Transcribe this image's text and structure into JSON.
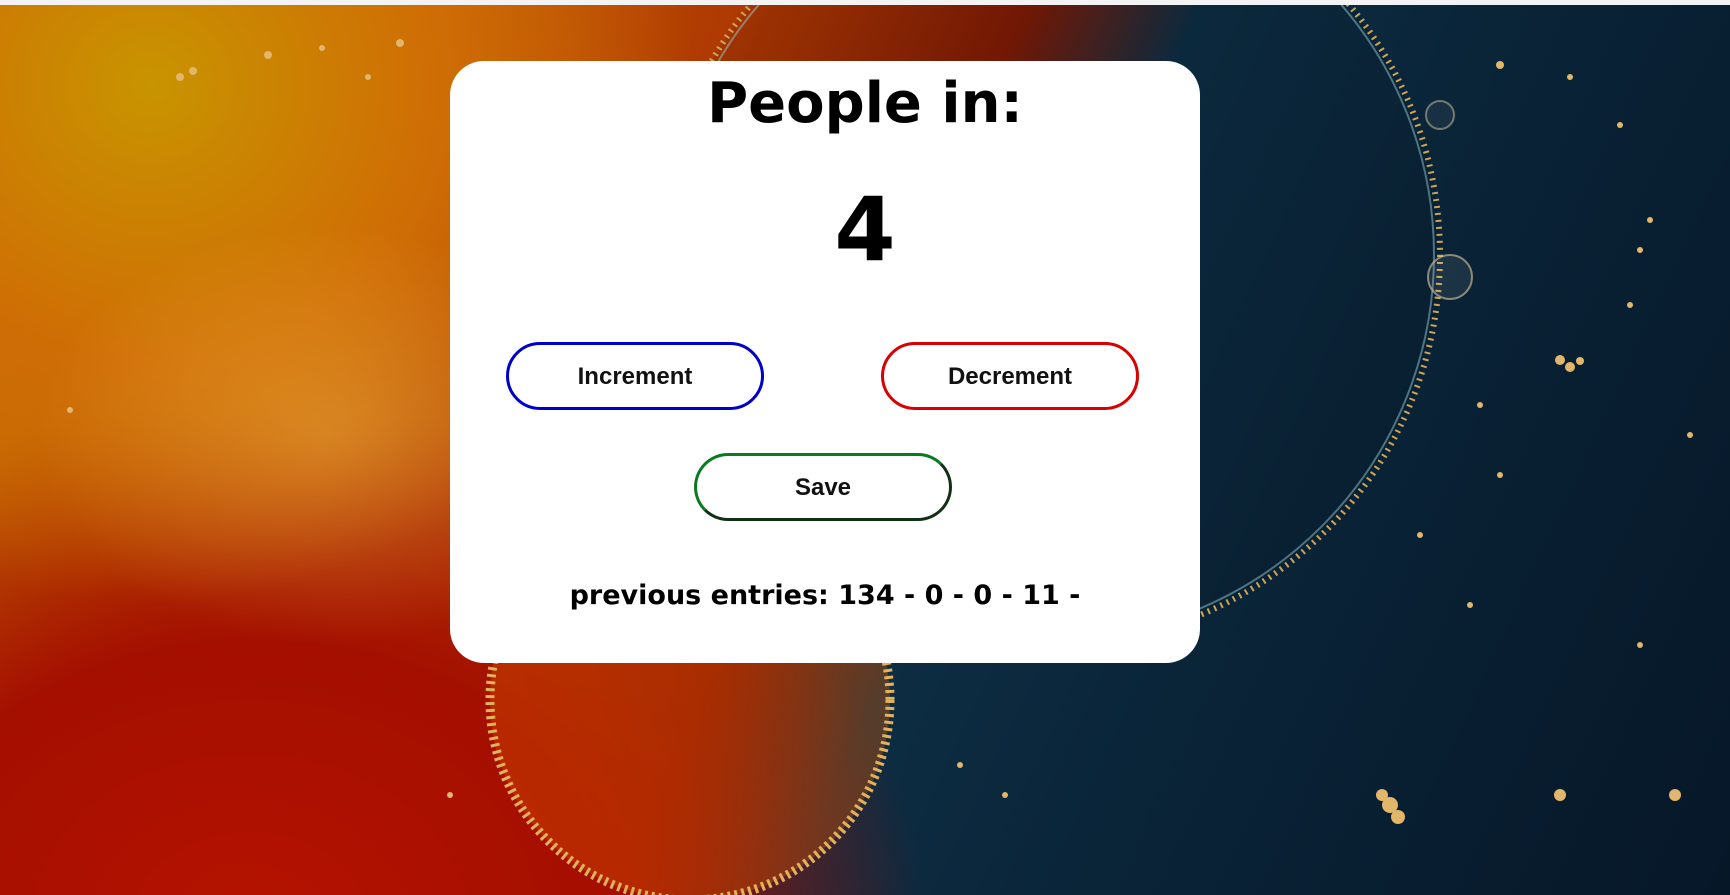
{
  "counter": {
    "title": "People in:",
    "value": "4"
  },
  "buttons": {
    "increment_label": "Increment",
    "decrement_label": "Decrement",
    "save_label": "Save"
  },
  "history": {
    "label": "previous entries:",
    "entries_text": "134 - 0 - 0 - 11 -"
  },
  "colors": {
    "increment_border": "#0000c8",
    "decrement_border": "#d80000",
    "save_border": "#0a7a1f",
    "card_background": "#ffffff"
  }
}
